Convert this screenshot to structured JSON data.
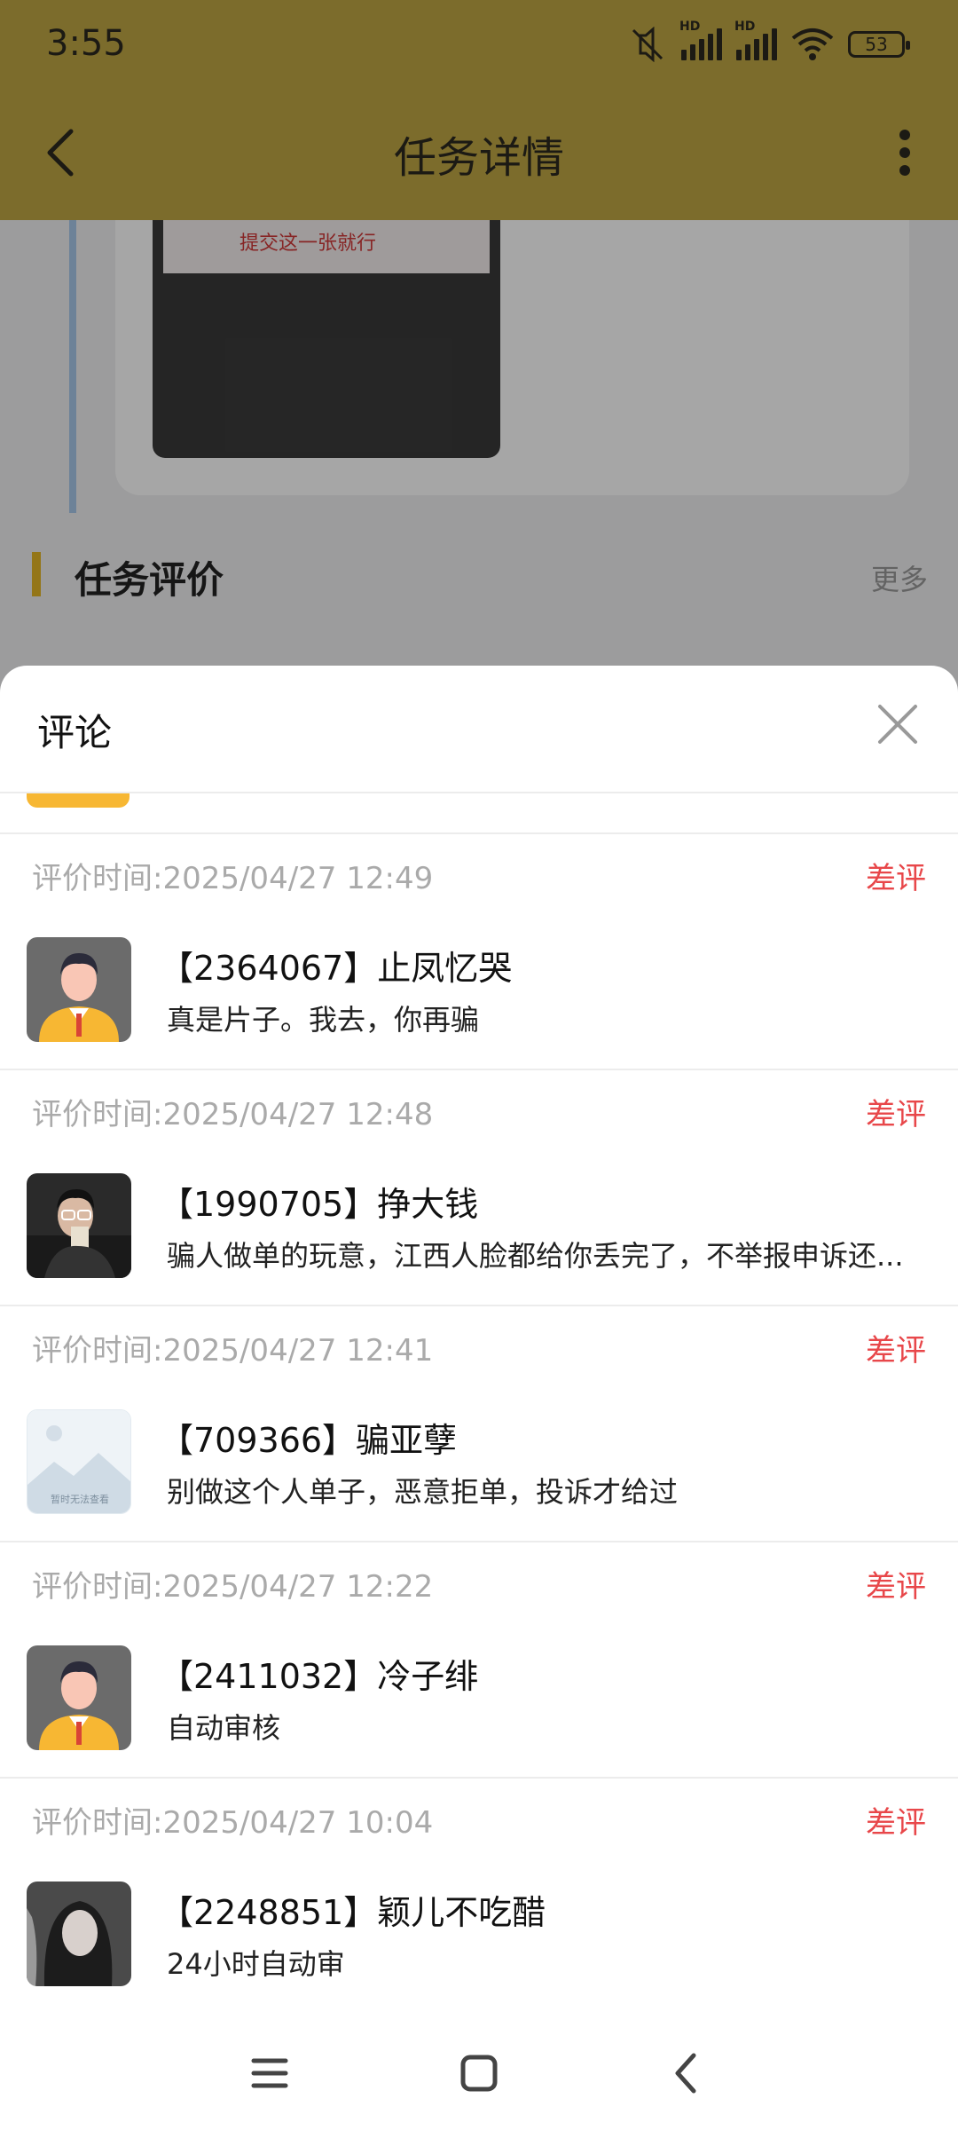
{
  "status": {
    "time": "3:55",
    "hd1": "HD",
    "hd2": "HD",
    "battery": "53"
  },
  "appbar": {
    "title": "任务详情"
  },
  "background": {
    "image_text": "提交这一张就行",
    "section_title": "任务评价",
    "more": "更多"
  },
  "sheet": {
    "title": "评论",
    "reviews": [
      {
        "time": "评价时间:2025/04/27 12:49",
        "tag": "差评",
        "name": "【2364067】止凤忆哭",
        "message": "真是片子。我去，你再骗",
        "avatar": "default-avatar"
      },
      {
        "time": "评价时间:2025/04/27 12:48",
        "tag": "差评",
        "name": "【1990705】挣大钱",
        "message": "骗人做单的玩意，江西人脸都给你丢完了，不举报申诉还...",
        "avatar": "photo-avatar"
      },
      {
        "time": "评价时间:2025/04/27 12:41",
        "tag": "差评",
        "name": "【709366】骗亚孽",
        "message": "别做这个人单子，恶意拒单，投诉才给过",
        "avatar": "placeholder-avatar",
        "avatar_text": "暂时无法查看"
      },
      {
        "time": "评价时间:2025/04/27 12:22",
        "tag": "差评",
        "name": "【2411032】冷子绯",
        "message": "自动审核",
        "avatar": "default-avatar"
      },
      {
        "time": "评价时间:2025/04/27 10:04",
        "tag": "差评",
        "name": "【2248851】颖儿不吃醋",
        "message": "24小时自动审",
        "avatar": "photo-avatar"
      }
    ]
  },
  "colors": {
    "appbar": "#7c6c2c",
    "accent": "#e4b626",
    "bad_review": "#e8474a"
  }
}
